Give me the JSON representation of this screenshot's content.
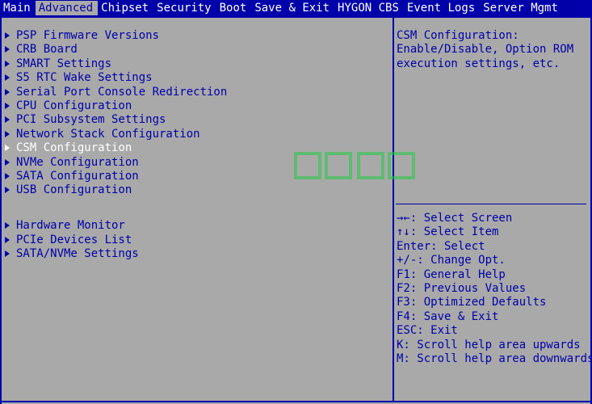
{
  "menu": [
    {
      "label": "Main",
      "active": false
    },
    {
      "label": "Advanced",
      "active": true
    },
    {
      "label": "Chipset",
      "active": false
    },
    {
      "label": "Security",
      "active": false
    },
    {
      "label": "Boot",
      "active": false
    },
    {
      "label": "Save & Exit",
      "active": false
    },
    {
      "label": "HYGON CBS",
      "active": false
    },
    {
      "label": "Event Logs",
      "active": false
    },
    {
      "label": "Server Mgmt",
      "active": false
    }
  ],
  "items_group1": [
    {
      "label": "PSP Firmware Versions"
    },
    {
      "label": "CRB Board"
    },
    {
      "label": "SMART Settings"
    },
    {
      "label": "S5 RTC Wake Settings"
    },
    {
      "label": "Serial Port Console Redirection"
    },
    {
      "label": "CPU Configuration"
    },
    {
      "label": "PCI Subsystem Settings"
    },
    {
      "label": "Network Stack Configuration"
    },
    {
      "label": "CSM Configuration",
      "selected": true
    },
    {
      "label": "NVMe Configuration"
    },
    {
      "label": "SATA Configuration"
    },
    {
      "label": "USB Configuration"
    }
  ],
  "items_group2": [
    {
      "label": "Hardware Monitor"
    },
    {
      "label": "PCIe Devices List"
    },
    {
      "label": "SATA/NVMe Settings"
    }
  ],
  "help": {
    "lines": [
      "CSM Configuration:",
      "Enable/Disable, Option ROM",
      "execution settings, etc."
    ]
  },
  "keys": [
    "→←: Select Screen",
    "↑↓: Select Item",
    "Enter: Select",
    "+/-: Change Opt.",
    "F1: General Help",
    "F2: Previous Values",
    "F3: Optimized Defaults",
    "F4: Save & Exit",
    "ESC: Exit",
    "K: Scroll help area upwards",
    "M: Scroll help area downwards"
  ],
  "colors": {
    "background": "#a9a9a9",
    "accent": "#0000aa",
    "highlight": "#ffffff",
    "watermark": "#22cc44"
  }
}
